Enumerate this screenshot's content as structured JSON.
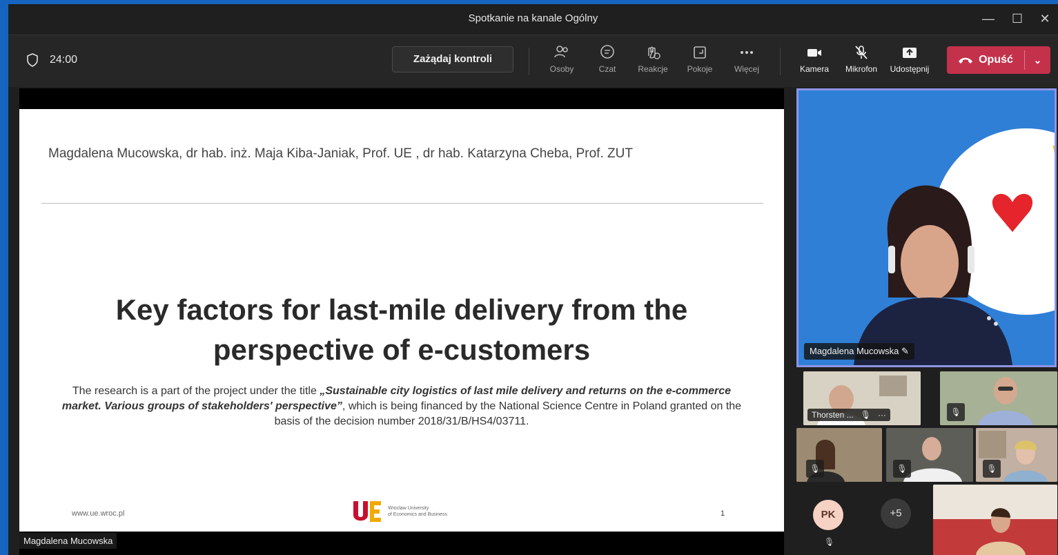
{
  "window": {
    "title": "Spotkanie na kanale Ogólny",
    "controls": {
      "minimize": "—",
      "maximize": "☐",
      "close": "✕"
    }
  },
  "toolbar": {
    "timer": "24:00",
    "request_control_label": "Zażądaj kontroli",
    "buttons": [
      {
        "label": "Osoby",
        "icon": "people-icon"
      },
      {
        "label": "Czat",
        "icon": "chat-icon"
      },
      {
        "label": "Reakcje",
        "icon": "reactions-icon"
      },
      {
        "label": "Pokoje",
        "icon": "rooms-icon"
      },
      {
        "label": "Więcej",
        "icon": "more-icon"
      }
    ],
    "media": [
      {
        "label": "Kamera",
        "icon": "camera-icon"
      },
      {
        "label": "Mikrofon",
        "icon": "mic-off-icon"
      },
      {
        "label": "Udostępnij",
        "icon": "share-icon"
      }
    ],
    "leave_label": "Opuść"
  },
  "slide": {
    "authors": "Magdalena Mucowska, dr hab. inż. Maja Kiba-Janiak, Prof. UE , dr hab. Katarzyna Cheba, Prof. ZUT",
    "title_line1": "Key factors for last-mile delivery from the",
    "title_line2": "perspective of e-customers",
    "note_prefix": "The research is a part of the project under the title ",
    "note_project": "„Sustainable city logistics of last mile delivery and returns on the e-commerce market. Various groups of stakeholders' perspective”",
    "note_suffix": ", which is being financed by the National Science Centre in Poland granted on the basis of the decision number 2018/31/B/HS4/03711.",
    "url": "www.ue.wroc.pl",
    "logo_mark": "UE",
    "university_line1": "Wroclaw University",
    "university_line2": "of Economics and Business",
    "page_number": "1"
  },
  "presenter_label": "Magdalena Mucowska",
  "main_participant": {
    "name": "Magdalena Mucowska"
  },
  "participants": {
    "thumb1_name": "Thorsten ...",
    "thumb1_more": "···",
    "avatar_initials": "PK",
    "overflow_count": "+5"
  },
  "colors": {
    "leave": "#c4314b",
    "pin_border": "#8f95e6",
    "frame": "#1565c0"
  }
}
